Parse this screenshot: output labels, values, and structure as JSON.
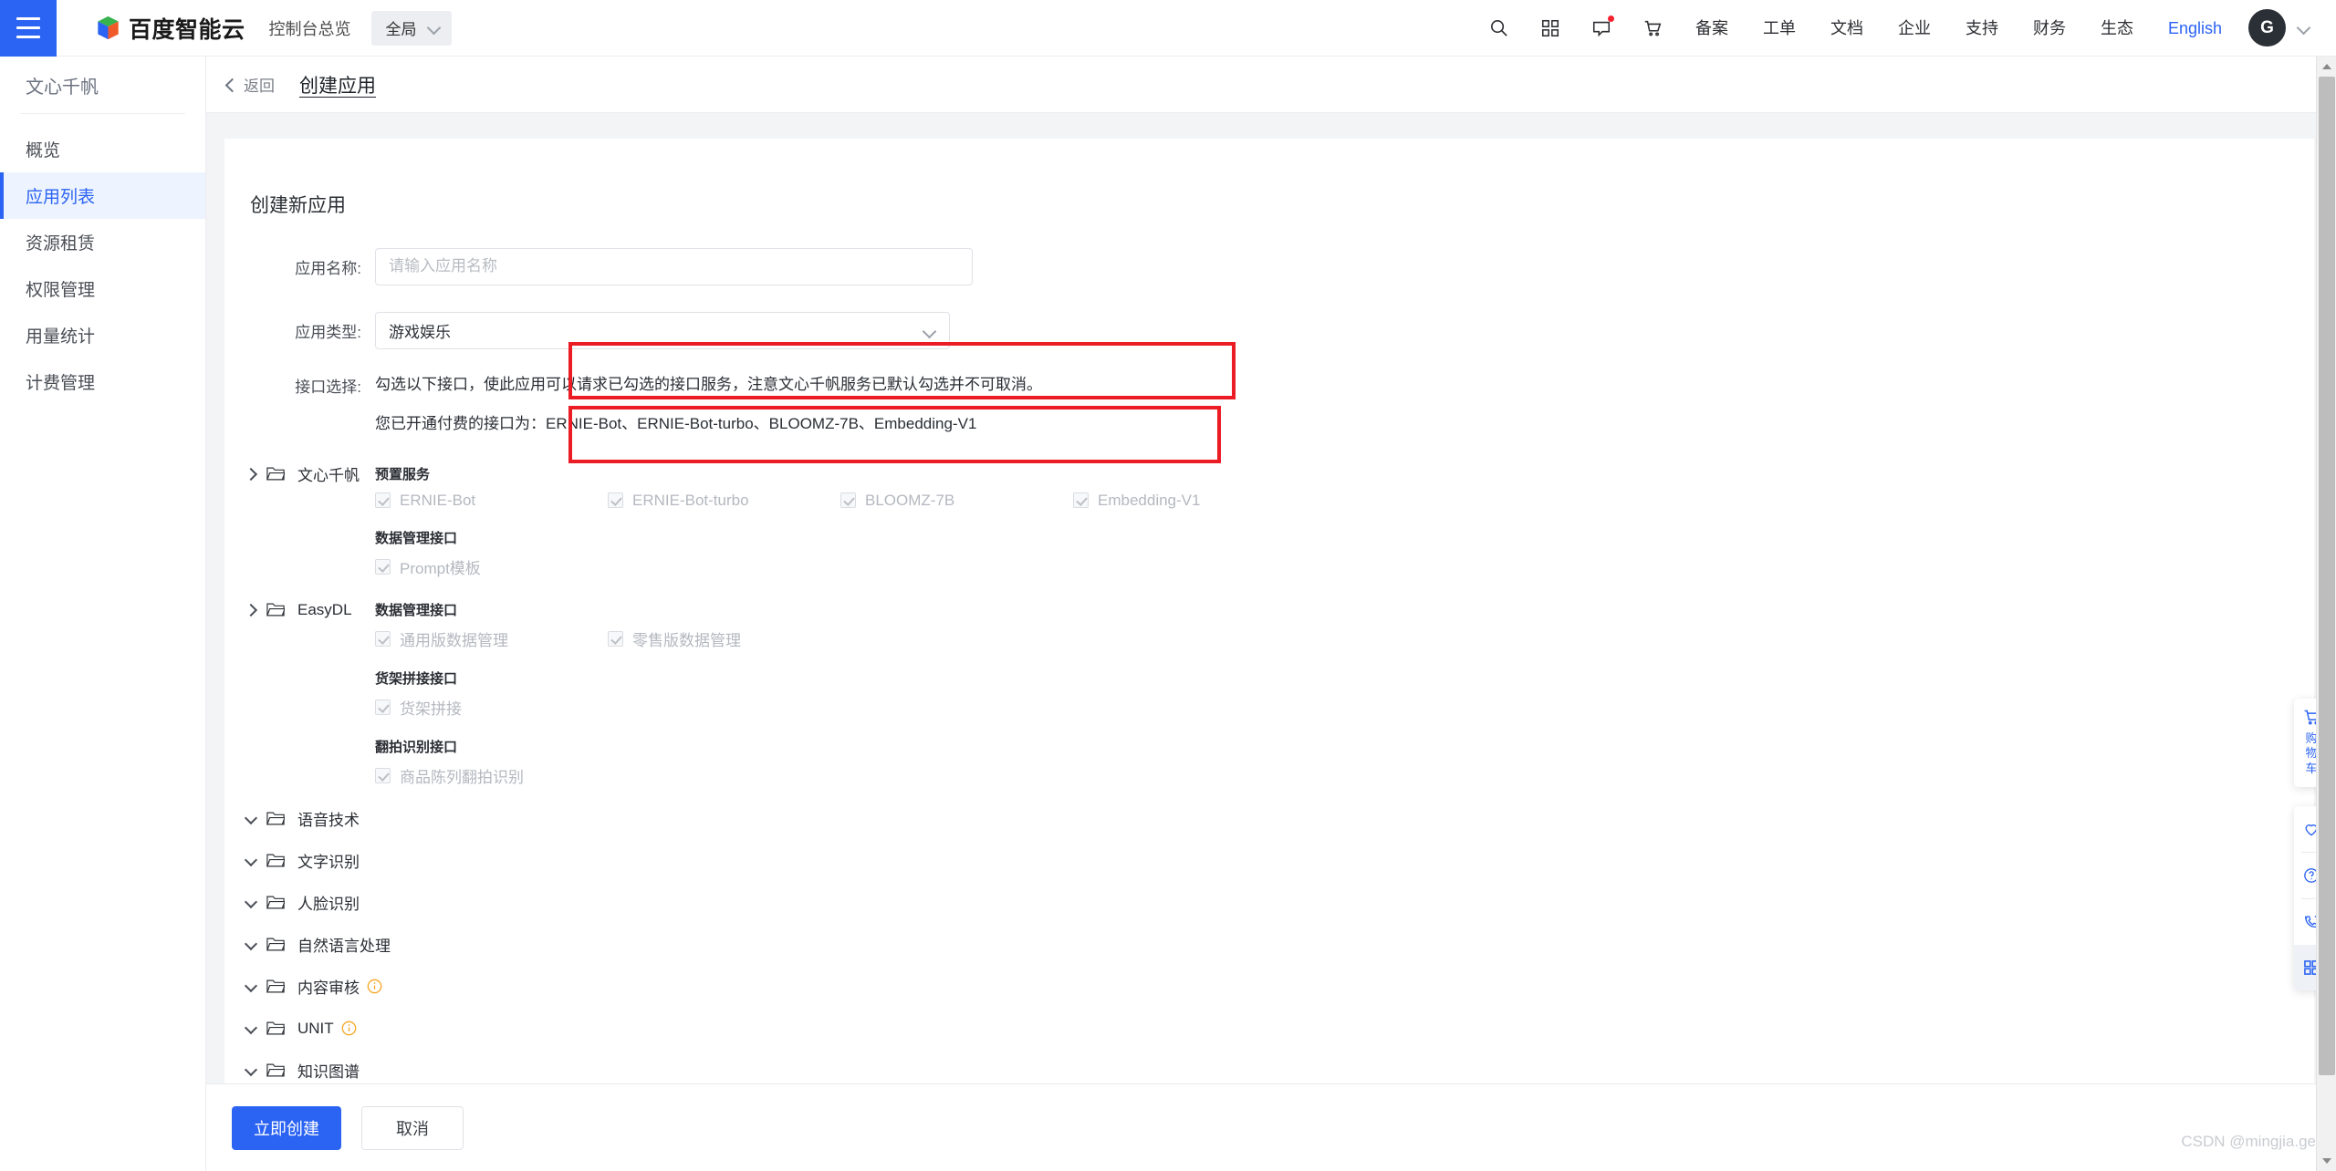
{
  "header": {
    "menu_icon": "hamburger-icon",
    "brand": "百度智能云",
    "console_link": "控制台总览",
    "region": "全局",
    "nav_icons": [
      {
        "name": "search-icon",
        "label": "搜索"
      },
      {
        "name": "apps-grid-icon",
        "label": "产品"
      },
      {
        "name": "message-icon",
        "label": "消息"
      },
      {
        "name": "cart-icon",
        "label": "购物车"
      }
    ],
    "nav_items": [
      "备案",
      "工单",
      "文档",
      "企业",
      "支持",
      "财务",
      "生态"
    ],
    "language": "English",
    "avatar_initial": "G"
  },
  "sidebar": {
    "title": "文心千帆",
    "items": [
      {
        "label": "概览",
        "active": false
      },
      {
        "label": "应用列表",
        "active": true
      },
      {
        "label": "资源租赁",
        "active": false
      },
      {
        "label": "权限管理",
        "active": false
      },
      {
        "label": "用量统计",
        "active": false
      },
      {
        "label": "计费管理",
        "active": false
      }
    ]
  },
  "breadcrumb": {
    "back_label": "返回",
    "title": "创建应用"
  },
  "card": {
    "title": "创建新应用",
    "fields": {
      "app_name_label": "应用名称:",
      "app_name_value": "",
      "app_name_placeholder": "请输入应用名称",
      "app_type_label": "应用类型:",
      "app_type_value": "游戏娱乐",
      "api_label": "接口选择:",
      "api_hint_main": "勾选以下接口，使此应用可以请求已勾选的接口服务，注意文心千帆服务已默认勾选并不可取消。",
      "api_hint_sub": "您已开通付费的接口为：ERNIE-Bot、ERNIE-Bot-turbo、BLOOMZ-7B、Embedding-V1"
    }
  },
  "tree": [
    {
      "label": "文心千帆",
      "expanded": true,
      "chevron": "chevron-right-icon",
      "has_info": false,
      "groups": [
        {
          "title": "预置服务",
          "items": [
            {
              "label": "ERNIE-Bot",
              "checked": true,
              "disabled": true
            },
            {
              "label": "ERNIE-Bot-turbo",
              "checked": true,
              "disabled": true
            },
            {
              "label": "BLOOMZ-7B",
              "checked": true,
              "disabled": true
            },
            {
              "label": "Embedding-V1",
              "checked": true,
              "disabled": true
            }
          ]
        },
        {
          "title": "数据管理接口",
          "items": [
            {
              "label": "Prompt模板",
              "checked": true,
              "disabled": true
            }
          ]
        }
      ]
    },
    {
      "label": "EasyDL",
      "expanded": true,
      "chevron": "chevron-right-icon",
      "has_info": false,
      "groups": [
        {
          "title": "数据管理接口",
          "items": [
            {
              "label": "通用版数据管理",
              "checked": true,
              "disabled": true
            },
            {
              "label": "零售版数据管理",
              "checked": true,
              "disabled": true
            }
          ]
        },
        {
          "title": "货架拼接接口",
          "items": [
            {
              "label": "货架拼接",
              "checked": true,
              "disabled": true
            }
          ]
        },
        {
          "title": "翻拍识别接口",
          "items": [
            {
              "label": "商品陈列翻拍识别",
              "checked": true,
              "disabled": true
            }
          ]
        }
      ]
    },
    {
      "label": "语音技术",
      "expanded": false,
      "chevron": "chevron-down-icon",
      "has_info": false,
      "groups": []
    },
    {
      "label": "文字识别",
      "expanded": false,
      "chevron": "chevron-down-icon",
      "has_info": false,
      "groups": []
    },
    {
      "label": "人脸识别",
      "expanded": false,
      "chevron": "chevron-down-icon",
      "has_info": false,
      "groups": []
    },
    {
      "label": "自然语言处理",
      "expanded": false,
      "chevron": "chevron-down-icon",
      "has_info": false,
      "groups": []
    },
    {
      "label": "内容审核",
      "expanded": false,
      "chevron": "chevron-down-icon",
      "has_info": true,
      "groups": []
    },
    {
      "label": "UNIT",
      "expanded": false,
      "chevron": "chevron-down-icon",
      "has_info": true,
      "groups": []
    },
    {
      "label": "知识图谱",
      "expanded": false,
      "chevron": "chevron-down-icon",
      "has_info": false,
      "groups": []
    }
  ],
  "footer": {
    "submit_label": "立即创建",
    "cancel_label": "取消"
  },
  "right_toolbar": {
    "cart_label": "购物车",
    "buttons": [
      {
        "name": "favorite-heart-icon"
      },
      {
        "name": "help-question-icon"
      },
      {
        "name": "phone-support-icon"
      },
      {
        "name": "grid-apps-icon"
      }
    ]
  },
  "watermark": "CSDN @mingjia.ge",
  "colors": {
    "accent": "#2b63f3",
    "annotation": "#ec1c24",
    "sidebar_active_bg": "#eef4ff",
    "info_icon": "#f5a623"
  }
}
